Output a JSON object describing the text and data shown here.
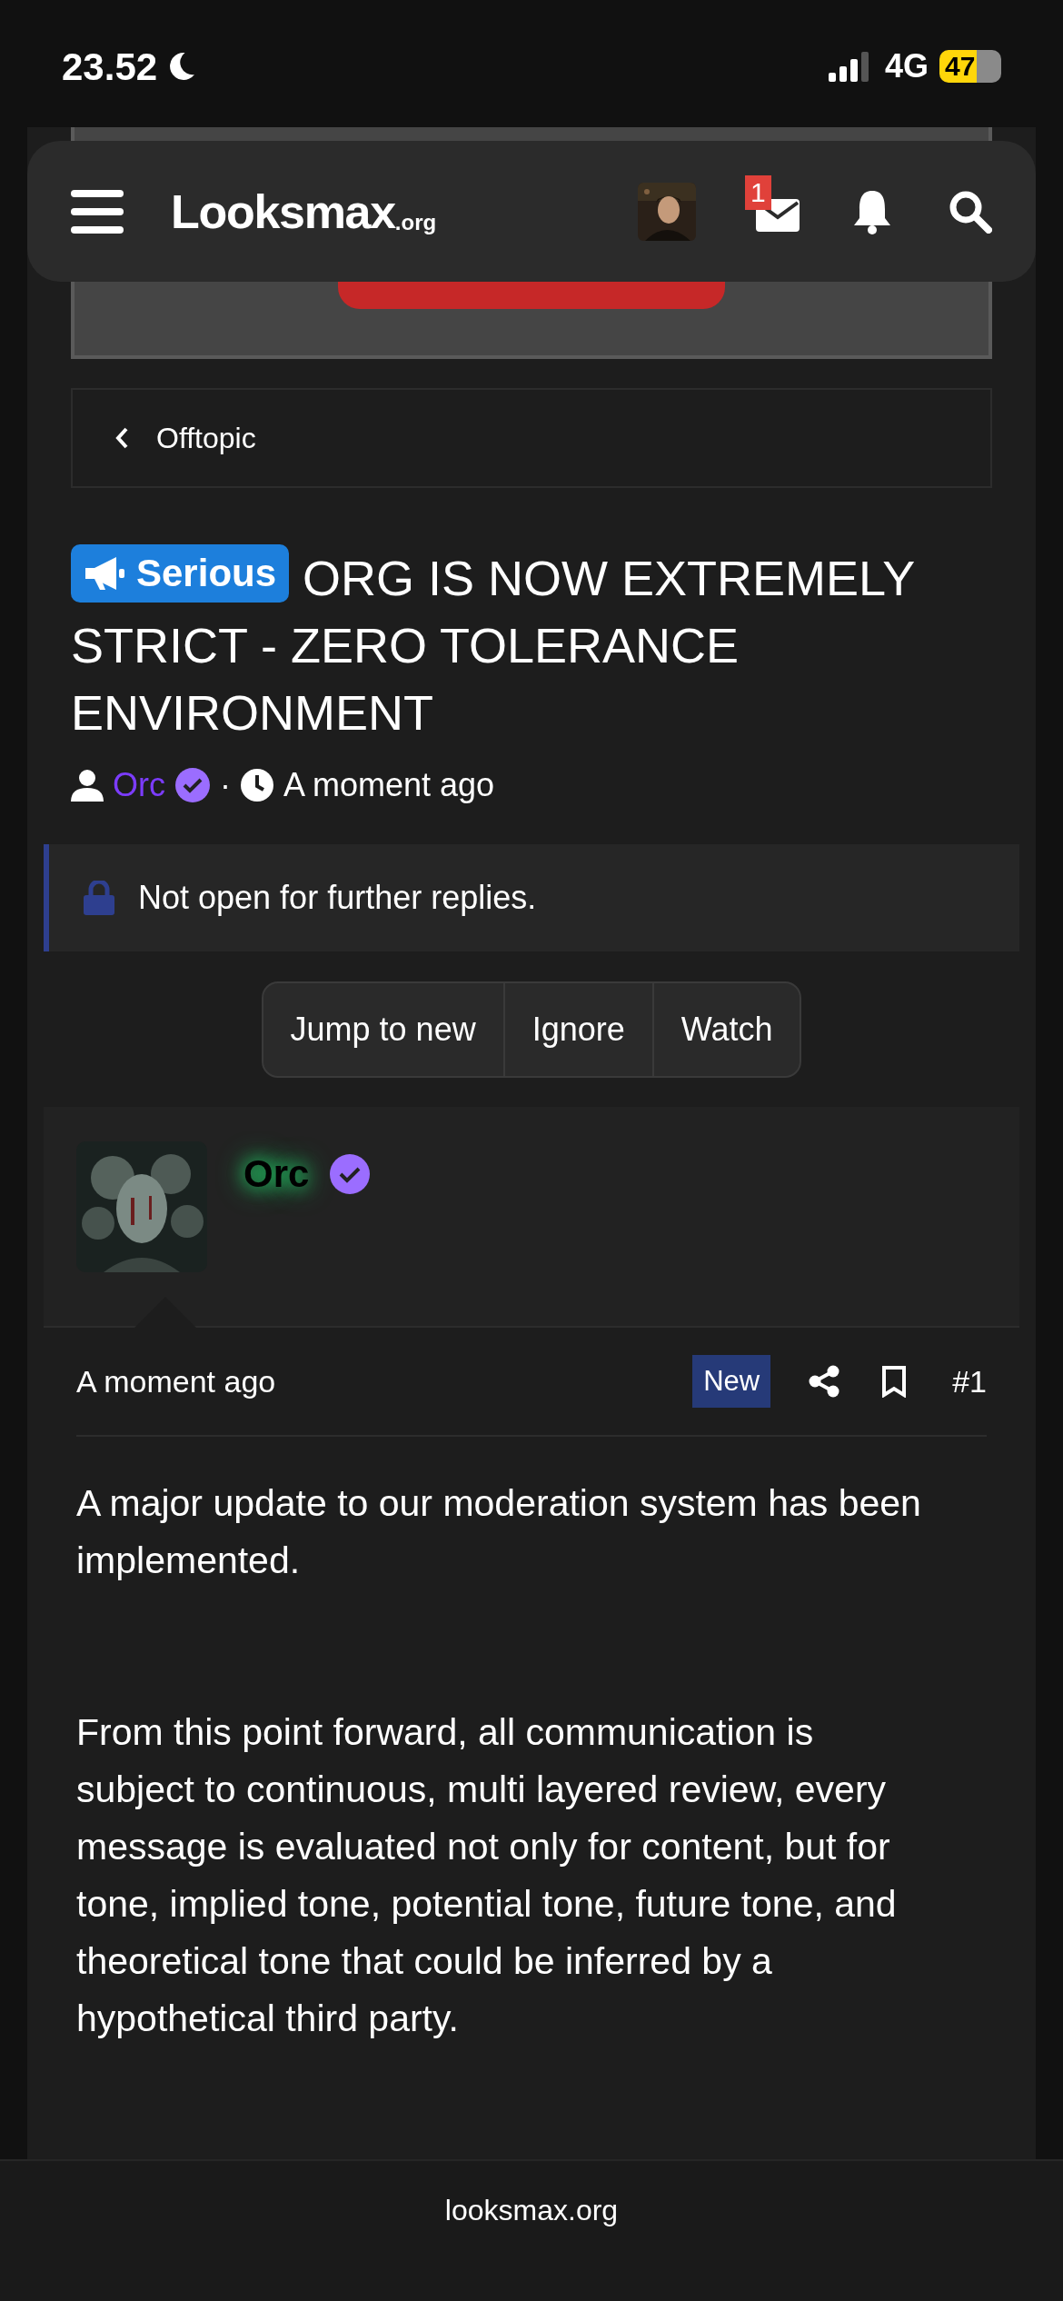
{
  "status_bar": {
    "time": "23.52",
    "network": "4G",
    "battery": "47"
  },
  "header": {
    "logo": "Looksmax",
    "logo_suffix": ".org",
    "notification_count": "1"
  },
  "breadcrumb": {
    "label": "Offtopic"
  },
  "thread": {
    "prefix": "Serious",
    "title": "ORG IS NOW EXTREMELY STRICT - ZERO TOLERANCE ENVIRONMENT",
    "author": "Orc",
    "separator": "·",
    "time": "A moment ago"
  },
  "notice": "Not open for further replies.",
  "actions": [
    "Jump to new",
    "Ignore",
    "Watch"
  ],
  "post": {
    "author": "Orc",
    "time": "A moment ago",
    "badge": "New",
    "number": "#1",
    "paragraphs": [
      "A major update to our moderation system has been implemented.",
      "From this point forward, all communication is subject to continuous, multi layered review, every message is evaluated not only for content, but for tone, implied tone, potential tone, future tone, and theoretical tone that could be inferred by a hypothetical third party."
    ]
  },
  "footer": {
    "domain": "looksmax.org"
  }
}
